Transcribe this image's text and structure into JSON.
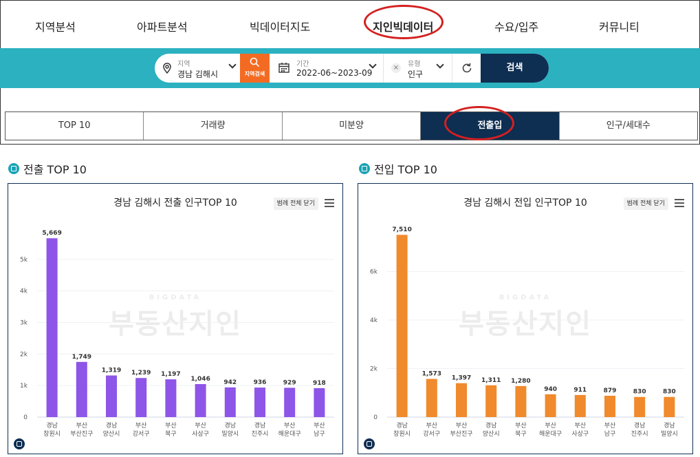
{
  "topnav": {
    "items": [
      {
        "label": "지역분석"
      },
      {
        "label": "아파트분석"
      },
      {
        "label": "빅데이터지도"
      },
      {
        "label": "지인빅데이터",
        "active": true
      },
      {
        "label": "수요/입주"
      },
      {
        "label": "커뮤니티"
      }
    ]
  },
  "search": {
    "region_label": "지역",
    "region_value": "경남 김해시",
    "region_search_button": "지역검색",
    "period_label": "기간",
    "period_value": "2022-06~2023-09",
    "type_label": "유형",
    "type_value": "인구",
    "search_button": "검색"
  },
  "tabs": [
    {
      "label": "TOP 10"
    },
    {
      "label": "거래량"
    },
    {
      "label": "미분양"
    },
    {
      "label": "전출입",
      "active": true
    },
    {
      "label": "인구/세대수"
    }
  ],
  "watermark": {
    "top": "BIGDATA",
    "main": "부동산지인"
  },
  "sections": {
    "left_title": "전출 TOP 10",
    "right_title": "전입 TOP 10"
  },
  "legend_button": "범례 전체 닫기",
  "colors": {
    "accent": "#2bb1c0",
    "navy": "#0e2e52",
    "orange_button": "#f36b22",
    "out_bar": "#8d55e8",
    "in_bar": "#f08a2c"
  },
  "chart_data": [
    {
      "type": "bar",
      "title": "경남 김해시 전출 인구TOP 10",
      "categories": [
        [
          "경남",
          "창원시"
        ],
        [
          "부산",
          "부산진구"
        ],
        [
          "경남",
          "양산시"
        ],
        [
          "부산",
          "강서구"
        ],
        [
          "부산",
          "북구"
        ],
        [
          "부산",
          "사상구"
        ],
        [
          "경남",
          "밀양시"
        ],
        [
          "경남",
          "진주시"
        ],
        [
          "부산",
          "해운대구"
        ],
        [
          "부산",
          "남구"
        ]
      ],
      "values": [
        5669,
        1749,
        1319,
        1239,
        1197,
        1046,
        942,
        936,
        929,
        918
      ],
      "value_labels": [
        "5,669",
        "1,749",
        "1,319",
        "1,239",
        "1,197",
        "1,046",
        "942",
        "936",
        "929",
        "918"
      ],
      "yticks": [
        0,
        1000,
        2000,
        3000,
        4000,
        5000
      ],
      "ytick_labels": [
        "0",
        "1k",
        "2k",
        "3k",
        "4k",
        "5k"
      ],
      "ylim": [
        0,
        6000
      ],
      "color": "#8d55e8",
      "grid": true
    },
    {
      "type": "bar",
      "title": "경남 김해시 전입 인구TOP 10",
      "categories": [
        [
          "경남",
          "창원시"
        ],
        [
          "부산",
          "강서구"
        ],
        [
          "부산",
          "부산진구"
        ],
        [
          "경남",
          "양산시"
        ],
        [
          "부산",
          "북구"
        ],
        [
          "부산",
          "해운대구"
        ],
        [
          "부산",
          "사상구"
        ],
        [
          "부산",
          "남구"
        ],
        [
          "경남",
          "진주시"
        ],
        [
          "경남",
          "밀양시"
        ]
      ],
      "values": [
        7510,
        1573,
        1397,
        1311,
        1280,
        940,
        911,
        879,
        830,
        830
      ],
      "value_labels": [
        "7,510",
        "1,573",
        "1,397",
        "1,311",
        "1,280",
        "940",
        "911",
        "879",
        "830",
        "830"
      ],
      "yticks": [
        0,
        2000,
        4000,
        6000
      ],
      "ytick_labels": [
        "0",
        "2k",
        "4k",
        "6k"
      ],
      "ylim": [
        0,
        7800
      ],
      "color": "#f08a2c",
      "grid": true
    }
  ]
}
